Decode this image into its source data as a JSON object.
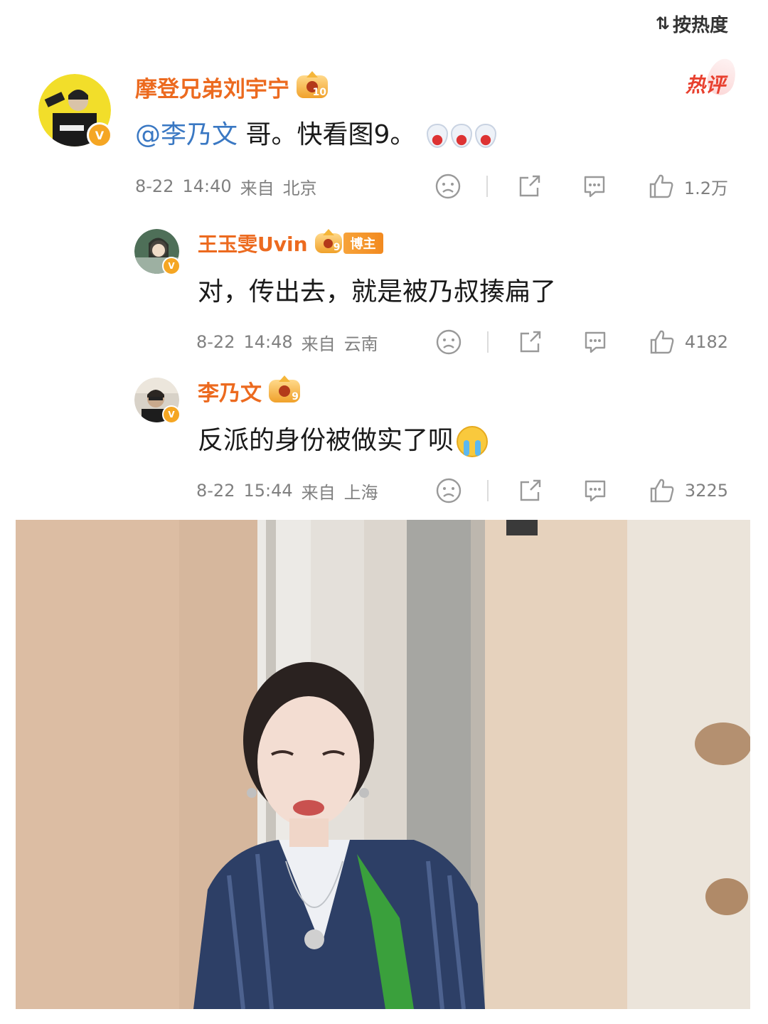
{
  "sort": {
    "label": "按热度",
    "icon": "sort-icon"
  },
  "comments": [
    {
      "user": "摩登兄弟刘宇宁",
      "level": "10",
      "verified": "V",
      "hot_badge": "热评",
      "mention": "@李乃文",
      "text": " 哥。快看图9。",
      "date": "8-22",
      "time": "14:40",
      "from_label": "来自",
      "location": "北京",
      "likes": "1.2万"
    },
    {
      "user": "王玉雯Uvin",
      "level": "9",
      "verified": "V",
      "tag": "博主",
      "text": "对，传出去，就是被乃叔揍扁了",
      "date": "8-22",
      "time": "14:48",
      "from_label": "来自",
      "location": "云南",
      "likes": "4182"
    },
    {
      "user": "李乃文",
      "level": "9",
      "verified": "V",
      "text": "反派的身份被做实了呗",
      "date": "8-22",
      "time": "15:44",
      "from_label": "来自",
      "location": "上海",
      "likes": "3225"
    }
  ],
  "colors": {
    "name": "#ec6a1f",
    "mention": "#3a78c3",
    "meta": "#808080",
    "hot": "#e8402f"
  }
}
